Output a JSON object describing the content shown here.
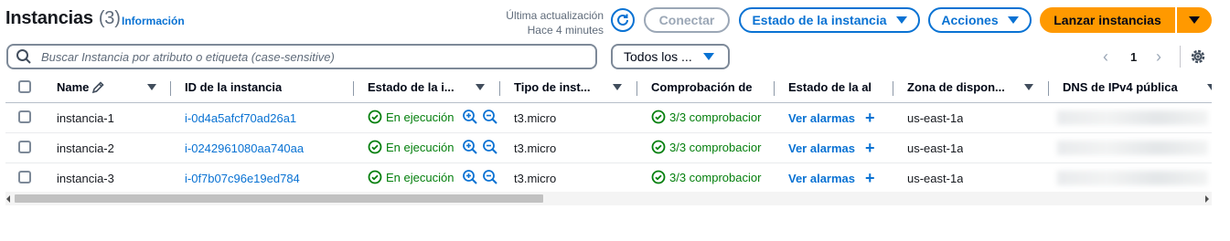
{
  "header": {
    "title": "Instancias",
    "count": "(3)",
    "info_link": "Información",
    "last_update_label": "Última actualización",
    "last_update_value": "Hace 4 minutes",
    "connect_label": "Conectar",
    "instance_state_label": "Estado de la instancia",
    "actions_label": "Acciones",
    "launch_label": "Lanzar instancias"
  },
  "search": {
    "placeholder": "Buscar Instancia por atributo o etiqueta (case-sensitive)"
  },
  "filter": {
    "selected": "Todos los ..."
  },
  "pagination": {
    "current_page": "1"
  },
  "table": {
    "columns": [
      "Name",
      "ID de la instancia",
      "Estado de la i...",
      "Tipo de inst...",
      "Comprobación de",
      "Estado de la al",
      "Zona de dispon...",
      "DNS de IPv4 pública"
    ],
    "rows": [
      {
        "name": "instancia-1",
        "id": "i-0d4a5afcf70ad26a1",
        "state": "En ejecución",
        "type": "t3.micro",
        "check": "3/3 comprobacior",
        "alarm": "Ver alarmas",
        "zone": "us-east-1a"
      },
      {
        "name": "instancia-2",
        "id": "i-0242961080aa740aa",
        "state": "En ejecución",
        "type": "t3.micro",
        "check": "3/3 comprobacior",
        "alarm": "Ver alarmas",
        "zone": "us-east-1a"
      },
      {
        "name": "instancia-3",
        "id": "i-0f7b07c96e19ed784",
        "state": "En ejecución",
        "type": "t3.micro",
        "check": "3/3 comprobacior",
        "alarm": "Ver alarmas",
        "zone": "us-east-1a"
      }
    ]
  },
  "colors": {
    "accent": "#0972d3",
    "primary_button": "#ff9900",
    "success": "#037f0c",
    "disabled": "#9ba7b6"
  }
}
